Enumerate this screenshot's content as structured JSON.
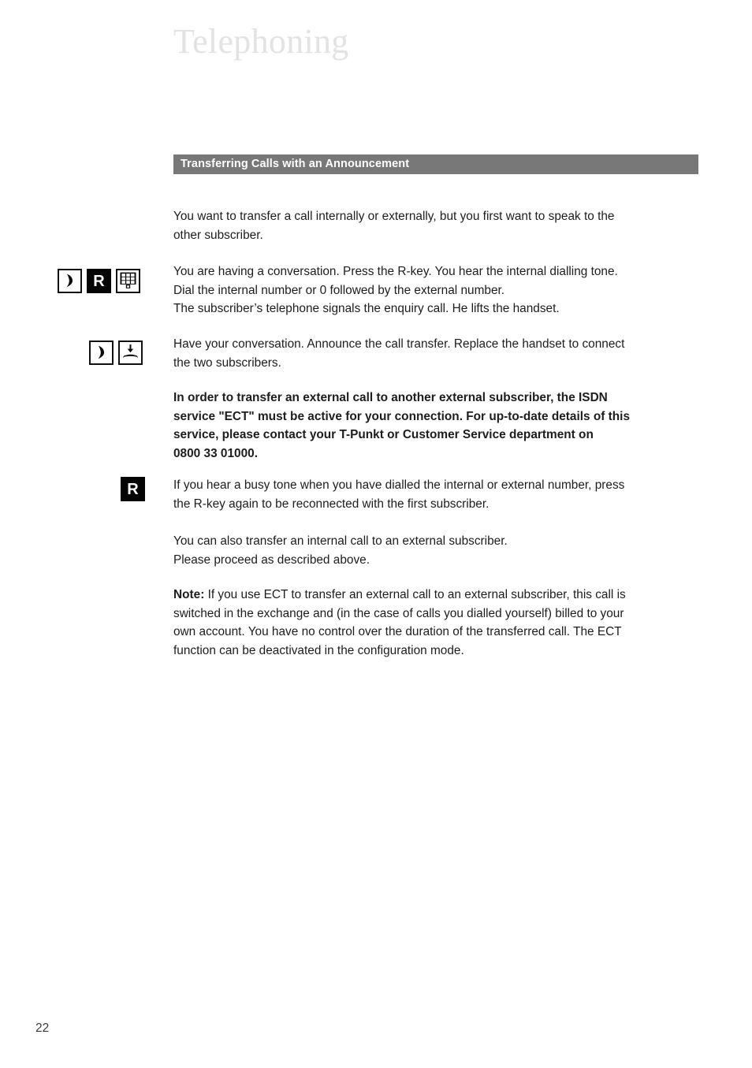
{
  "document": {
    "chapter_title": "Telephoning",
    "page_number": "22"
  },
  "section": {
    "heading": "Transferring Calls with an Announcement",
    "heading_bar_color": "#787878",
    "heading_text_color": "#ffffff"
  },
  "content": {
    "intro": {
      "line1": "You want to transfer a call internally or externally, but you first want to speak to the",
      "line2": "other subscriber."
    },
    "step1": {
      "line1": "You are having a conversation. Press the R-key. You hear the internal dialling tone.",
      "line2": "Dial the internal number or 0 followed by the external number.",
      "line3": "The subscriber’s telephone signals the enquiry call. He lifts the handset."
    },
    "step2": {
      "line1": "Have your conversation. Announce the call transfer. Replace the handset to connect",
      "line2": "the two subscribers."
    },
    "ect_notice": {
      "line1": "In order to transfer an external call to another external subscriber, the ISDN",
      "line2": "service \"ECT\" must be active for your connection. For up-to-date details of this",
      "line3": "service, please contact your T-Punkt or Customer Service department on",
      "line4": "0800 33 01000."
    },
    "busy_tone": {
      "line1": "If you hear a busy tone when you have dialled the internal or external number, press",
      "line2": "the R-key again to be reconnected with the first subscriber."
    },
    "internal_transfer": {
      "line1": "You can also transfer an internal call to an external subscriber.",
      "line2": "Please proceed as described above."
    },
    "note": {
      "lead": "Note:",
      "line1": " If you use ECT to transfer an external call to an external subscriber, this call is",
      "line2": "switched in the exchange and (in the case of calls you dialled yourself) billed to your",
      "line3": "own account. You have no control over the duration of the transferred call. The ECT",
      "line4": "function can be deactivated in the configuration mode."
    }
  },
  "icons": {
    "handset": "handset-lifted-icon",
    "r_key": "r-key-icon",
    "r_key_label": "R",
    "keypad": "keypad-dial-icon",
    "hangup": "handset-replace-icon"
  }
}
